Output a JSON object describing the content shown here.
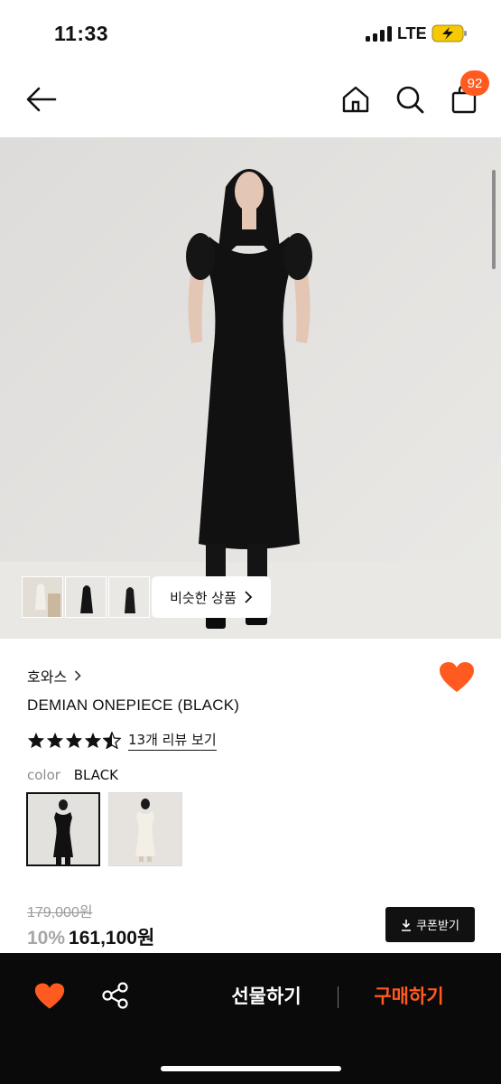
{
  "status_bar": {
    "time": "11:33",
    "network": "LTE",
    "signal_icon": "signal-bars-icon",
    "battery_icon": "battery-charging-icon"
  },
  "nav": {
    "back_icon": "arrow-left-icon",
    "home_icon": "home-icon",
    "search_icon": "search-icon",
    "cart_icon": "shopping-bag-icon",
    "cart_count": "92"
  },
  "gallery": {
    "thumbnails": [
      {
        "alt": "product-photo-1"
      },
      {
        "alt": "product-photo-2"
      },
      {
        "alt": "product-photo-3"
      }
    ],
    "similar_label": "비슷한 상품"
  },
  "product": {
    "brand": "호와스",
    "name": "DEMIAN ONEPIECE (BLACK)",
    "rating": 4.5,
    "review_link": "13개 리뷰 보기",
    "color_label": "color",
    "color_value": "BLACK",
    "color_options": [
      "BLACK",
      "IVORY"
    ],
    "original_price": "179,000원",
    "discount": "10%",
    "price": "161,100원",
    "coupon_label": "쿠폰받기"
  },
  "bottom_bar": {
    "wish_icon": "heart-icon",
    "share_icon": "share-icon",
    "gift_label": "선물하기",
    "buy_label": "구매하기"
  },
  "colors": {
    "accent": "#ff5a1f",
    "bottom_bar_bg": "#0a0a0a",
    "text": "#111111"
  }
}
